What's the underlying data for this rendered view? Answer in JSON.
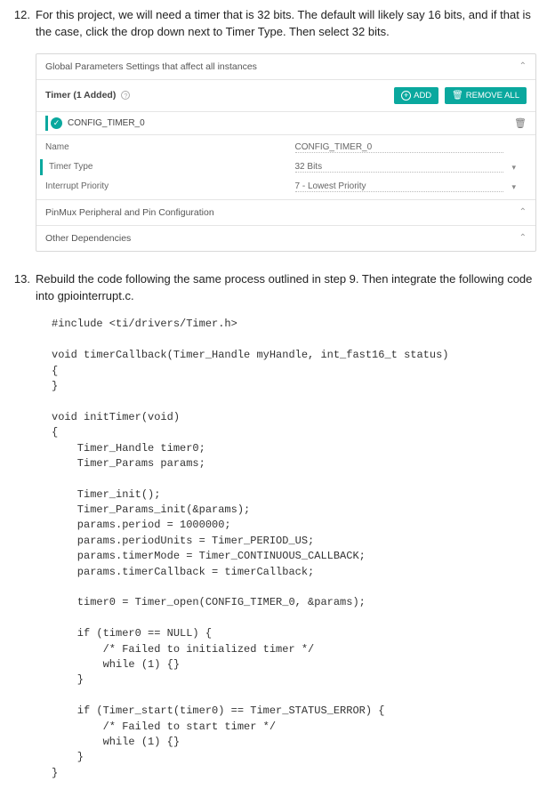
{
  "step12": {
    "number": "12.",
    "text": "For this project, we will need a timer that is 32 bits. The default will likely say 16 bits, and if that is the case, click the drop down next to Timer Type. Then select 32 bits."
  },
  "panel": {
    "globalParams": "Global Parameters   Settings that affect all instances",
    "timerHeader": "Timer (1 Added)",
    "addBtn": "ADD",
    "removeBtn": "REMOVE ALL",
    "configName": "CONFIG_TIMER_0",
    "propNameLabel": "Name",
    "propNameValue": "CONFIG_TIMER_0",
    "propTypeLabel": "Timer Type",
    "propTypeValue": "32 Bits",
    "propPriorityLabel": "Interrupt Priority",
    "propPriorityValue": "7 - Lowest Priority",
    "pinmux": "PinMux   Peripheral and Pin Configuration",
    "otherDeps": "Other Dependencies"
  },
  "step13": {
    "number": "13.",
    "text": "Rebuild the code following the same process outlined in step 9. Then integrate the following code into gpiointerrupt.c."
  },
  "code": "#include <ti/drivers/Timer.h>\n\nvoid timerCallback(Timer_Handle myHandle, int_fast16_t status)\n{\n}\n\nvoid initTimer(void)\n{\n    Timer_Handle timer0;\n    Timer_Params params;\n\n    Timer_init();\n    Timer_Params_init(&params);\n    params.period = 1000000;\n    params.periodUnits = Timer_PERIOD_US;\n    params.timerMode = Timer_CONTINUOUS_CALLBACK;\n    params.timerCallback = timerCallback;\n\n    timer0 = Timer_open(CONFIG_TIMER_0, &params);\n\n    if (timer0 == NULL) {\n        /* Failed to initialized timer */\n        while (1) {}\n    }\n\n    if (Timer_start(timer0) == Timer_STATUS_ERROR) {\n        /* Failed to start timer */\n        while (1) {}\n    }\n}"
}
